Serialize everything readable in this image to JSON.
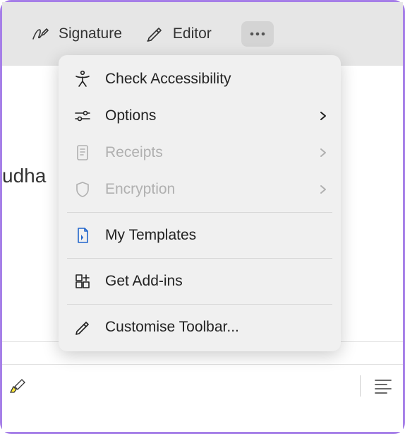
{
  "toolbar": {
    "signature_label": "Signature",
    "editor_label": "Editor"
  },
  "bg": {
    "partial_text": "udha"
  },
  "menu": {
    "check_accessibility": "Check Accessibility",
    "options": "Options",
    "receipts": "Receipts",
    "encryption": "Encryption",
    "my_templates": "My Templates",
    "get_addins": "Get Add-ins",
    "customise_toolbar": "Customise Toolbar..."
  }
}
